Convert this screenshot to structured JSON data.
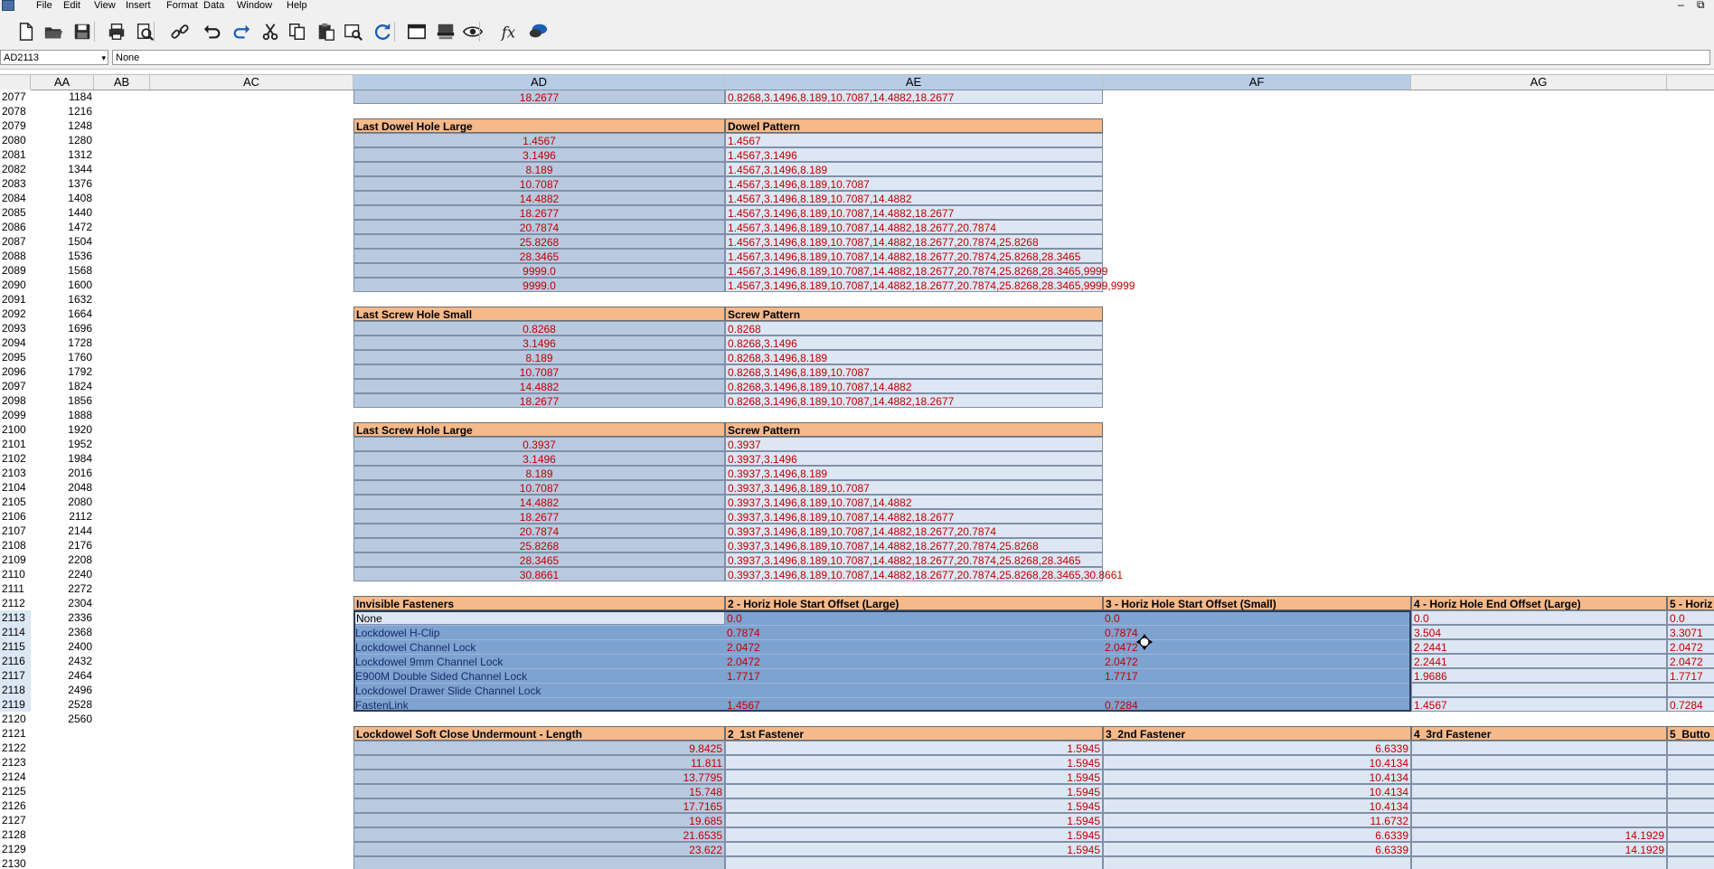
{
  "menu": [
    "File",
    "Edit",
    "View",
    "Insert",
    "Format",
    "Data",
    "Window",
    "Help"
  ],
  "window_controls": {
    "minimize": "–",
    "restore": "⧉"
  },
  "toolbar_icons": [
    "new-file-icon",
    "open-folder-icon",
    "save-icon",
    "print-icon",
    "print-preview-icon",
    "link-icon",
    "undo-icon",
    "redo-icon",
    "cut-icon",
    "copy-icon",
    "paste-icon",
    "find-icon",
    "refresh-icon",
    "window-icon",
    "display-icon",
    "eye-icon",
    "function-icon",
    "chat-icon"
  ],
  "namebox": "AD2113",
  "formula": "None",
  "columns": [
    {
      "label": "AA",
      "selected": false
    },
    {
      "label": "AB",
      "selected": false
    },
    {
      "label": "AC",
      "selected": false
    },
    {
      "label": "AD",
      "selected": true
    },
    {
      "label": "AE",
      "selected": true
    },
    {
      "label": "AF",
      "selected": true
    },
    {
      "label": "AG",
      "selected": false
    }
  ],
  "rows": [
    {
      "n": "2077",
      "aa": "1184",
      "cells": {
        "ad": {
          "t": "18.2677",
          "s": "dc"
        },
        "ae": {
          "t": "0.8268,3.1496,8.189,10.7087,14.4882,18.2677",
          "s": "dr"
        }
      }
    },
    {
      "n": "2078",
      "aa": "1216",
      "cells": {}
    },
    {
      "n": "2079",
      "aa": "1248",
      "cells": {
        "ad": {
          "t": "Last Dowel Hole Large",
          "s": "hdr"
        },
        "ae": {
          "t": "Dowel Pattern",
          "s": "hdr"
        }
      }
    },
    {
      "n": "2080",
      "aa": "1280",
      "cells": {
        "ad": {
          "t": "1.4567",
          "s": "dc"
        },
        "ae": {
          "t": "1.4567",
          "s": "dr"
        }
      }
    },
    {
      "n": "2081",
      "aa": "1312",
      "cells": {
        "ad": {
          "t": "3.1496",
          "s": "dc"
        },
        "ae": {
          "t": "1.4567,3.1496",
          "s": "dr"
        }
      }
    },
    {
      "n": "2082",
      "aa": "1344",
      "cells": {
        "ad": {
          "t": "8.189",
          "s": "dc"
        },
        "ae": {
          "t": "1.4567,3.1496,8.189",
          "s": "dr"
        }
      }
    },
    {
      "n": "2083",
      "aa": "1376",
      "cells": {
        "ad": {
          "t": "10.7087",
          "s": "dc"
        },
        "ae": {
          "t": "1.4567,3.1496,8.189,10.7087",
          "s": "dr"
        }
      }
    },
    {
      "n": "2084",
      "aa": "1408",
      "cells": {
        "ad": {
          "t": "14.4882",
          "s": "dc"
        },
        "ae": {
          "t": "1.4567,3.1496,8.189,10.7087,14.4882",
          "s": "dr"
        }
      }
    },
    {
      "n": "2085",
      "aa": "1440",
      "cells": {
        "ad": {
          "t": "18.2677",
          "s": "dc"
        },
        "ae": {
          "t": "1.4567,3.1496,8.189,10.7087,14.4882,18.2677",
          "s": "dr"
        }
      }
    },
    {
      "n": "2086",
      "aa": "1472",
      "cells": {
        "ad": {
          "t": "20.7874",
          "s": "dc"
        },
        "ae": {
          "t": "1.4567,3.1496,8.189,10.7087,14.4882,18.2677,20.7874",
          "s": "dr"
        }
      }
    },
    {
      "n": "2087",
      "aa": "1504",
      "cells": {
        "ad": {
          "t": "25.8268",
          "s": "dc"
        },
        "ae": {
          "t": "1.4567,3.1496,8.189,10.7087,14.4882,18.2677,20.7874,25.8268",
          "s": "dr"
        }
      }
    },
    {
      "n": "2088",
      "aa": "1536",
      "cells": {
        "ad": {
          "t": "28.3465",
          "s": "dc"
        },
        "ae": {
          "t": "1.4567,3.1496,8.189,10.7087,14.4882,18.2677,20.7874,25.8268,28.3465",
          "s": "dr"
        }
      }
    },
    {
      "n": "2089",
      "aa": "1568",
      "cells": {
        "ad": {
          "t": "9999.0",
          "s": "dc"
        },
        "ae": {
          "t": "1.4567,3.1496,8.189,10.7087,14.4882,18.2677,20.7874,25.8268,28.3465,9999",
          "s": "dr"
        }
      }
    },
    {
      "n": "2090",
      "aa": "1600",
      "cells": {
        "ad": {
          "t": "9999.0",
          "s": "dc"
        },
        "ae": {
          "t": "1.4567,3.1496,8.189,10.7087,14.4882,18.2677,20.7874,25.8268,28.3465,9999,9999",
          "s": "dr"
        }
      }
    },
    {
      "n": "2091",
      "aa": "1632",
      "cells": {}
    },
    {
      "n": "2092",
      "aa": "1664",
      "cells": {
        "ad": {
          "t": "Last Screw Hole Small",
          "s": "hdr"
        },
        "ae": {
          "t": "Screw Pattern",
          "s": "hdr"
        }
      }
    },
    {
      "n": "2093",
      "aa": "1696",
      "cells": {
        "ad": {
          "t": "0.8268",
          "s": "dc"
        },
        "ae": {
          "t": "0.8268",
          "s": "dr"
        }
      }
    },
    {
      "n": "2094",
      "aa": "1728",
      "cells": {
        "ad": {
          "t": "3.1496",
          "s": "dc"
        },
        "ae": {
          "t": "0.8268,3.1496",
          "s": "dr"
        }
      }
    },
    {
      "n": "2095",
      "aa": "1760",
      "cells": {
        "ad": {
          "t": "8.189",
          "s": "dc"
        },
        "ae": {
          "t": "0.8268,3.1496,8.189",
          "s": "dr"
        }
      }
    },
    {
      "n": "2096",
      "aa": "1792",
      "cells": {
        "ad": {
          "t": "10.7087",
          "s": "dc"
        },
        "ae": {
          "t": "0.8268,3.1496,8.189,10.7087",
          "s": "dr"
        }
      }
    },
    {
      "n": "2097",
      "aa": "1824",
      "cells": {
        "ad": {
          "t": "14.4882",
          "s": "dc"
        },
        "ae": {
          "t": "0.8268,3.1496,8.189,10.7087,14.4882",
          "s": "dr"
        }
      }
    },
    {
      "n": "2098",
      "aa": "1856",
      "cells": {
        "ad": {
          "t": "18.2677",
          "s": "dc"
        },
        "ae": {
          "t": "0.8268,3.1496,8.189,10.7087,14.4882,18.2677",
          "s": "dr"
        }
      }
    },
    {
      "n": "2099",
      "aa": "1888",
      "cells": {}
    },
    {
      "n": "2100",
      "aa": "1920",
      "cells": {
        "ad": {
          "t": "Last Screw Hole Large",
          "s": "hdr"
        },
        "ae": {
          "t": "Screw Pattern",
          "s": "hdr"
        }
      }
    },
    {
      "n": "2101",
      "aa": "1952",
      "cells": {
        "ad": {
          "t": "0.3937",
          "s": "dc"
        },
        "ae": {
          "t": "0.3937",
          "s": "dr"
        }
      }
    },
    {
      "n": "2102",
      "aa": "1984",
      "cells": {
        "ad": {
          "t": "3.1496",
          "s": "dc"
        },
        "ae": {
          "t": "0.3937,3.1496",
          "s": "dr"
        }
      }
    },
    {
      "n": "2103",
      "aa": "2016",
      "cells": {
        "ad": {
          "t": "8.189",
          "s": "dc"
        },
        "ae": {
          "t": "0.3937,3.1496,8.189",
          "s": "dr"
        }
      }
    },
    {
      "n": "2104",
      "aa": "2048",
      "cells": {
        "ad": {
          "t": "10.7087",
          "s": "dc"
        },
        "ae": {
          "t": "0.3937,3.1496,8.189,10.7087",
          "s": "dr"
        }
      }
    },
    {
      "n": "2105",
      "aa": "2080",
      "cells": {
        "ad": {
          "t": "14.4882",
          "s": "dc"
        },
        "ae": {
          "t": "0.3937,3.1496,8.189,10.7087,14.4882",
          "s": "dr"
        }
      }
    },
    {
      "n": "2106",
      "aa": "2112",
      "cells": {
        "ad": {
          "t": "18.2677",
          "s": "dc"
        },
        "ae": {
          "t": "0.3937,3.1496,8.189,10.7087,14.4882,18.2677",
          "s": "dr"
        }
      }
    },
    {
      "n": "2107",
      "aa": "2144",
      "cells": {
        "ad": {
          "t": "20.7874",
          "s": "dc"
        },
        "ae": {
          "t": "0.3937,3.1496,8.189,10.7087,14.4882,18.2677,20.7874",
          "s": "dr"
        }
      }
    },
    {
      "n": "2108",
      "aa": "2176",
      "cells": {
        "ad": {
          "t": "25.8268",
          "s": "dc"
        },
        "ae": {
          "t": "0.3937,3.1496,8.189,10.7087,14.4882,18.2677,20.7874,25.8268",
          "s": "dr"
        }
      }
    },
    {
      "n": "2109",
      "aa": "2208",
      "cells": {
        "ad": {
          "t": "28.3465",
          "s": "dc"
        },
        "ae": {
          "t": "0.3937,3.1496,8.189,10.7087,14.4882,18.2677,20.7874,25.8268,28.3465",
          "s": "dr"
        }
      }
    },
    {
      "n": "2110",
      "aa": "2240",
      "cells": {
        "ad": {
          "t": "30.8661",
          "s": "dc"
        },
        "ae": {
          "t": "0.3937,3.1496,8.189,10.7087,14.4882,18.2677,20.7874,25.8268,28.3465,30.8661",
          "s": "dr"
        }
      }
    },
    {
      "n": "2111",
      "aa": "2272",
      "cells": {}
    },
    {
      "n": "2112",
      "aa": "2304",
      "cells": {
        "ad": {
          "t": "Invisible Fasteners",
          "s": "hdr"
        },
        "ae": {
          "t": "2 - Horiz Hole Start Offset (Large)",
          "s": "hdr"
        },
        "af": {
          "t": "3 - Horiz Hole Start Offset (Small)",
          "s": "hdr"
        },
        "ag": {
          "t": "4 - Horiz Hole End Offset (Large)",
          "s": "hdr"
        },
        "ah": {
          "t": "5 - Horiz",
          "s": "hdr"
        }
      }
    },
    {
      "n": "2113",
      "aa": "2336",
      "sel": true,
      "cells": {
        "ad": {
          "t": "None",
          "s": "first"
        },
        "ae": {
          "t": "0.0",
          "s": "sr"
        },
        "af": {
          "t": "0.0",
          "s": "sr"
        },
        "ag": {
          "t": "0.0",
          "s": "dr"
        },
        "ah": {
          "t": "0.0",
          "s": "dr"
        }
      }
    },
    {
      "n": "2114",
      "aa": "2368",
      "sel": true,
      "cells": {
        "ad": {
          "t": "Lockdowel H-Clip",
          "s": "sl"
        },
        "ae": {
          "t": "0.7874",
          "s": "sr"
        },
        "af": {
          "t": "0.7874",
          "s": "sr"
        },
        "ag": {
          "t": "3.504",
          "s": "dr"
        },
        "ah": {
          "t": "3.3071",
          "s": "dr"
        }
      }
    },
    {
      "n": "2115",
      "aa": "2400",
      "sel": true,
      "cells": {
        "ad": {
          "t": "Lockdowel Channel Lock",
          "s": "sl"
        },
        "ae": {
          "t": "2.0472",
          "s": "sr"
        },
        "af": {
          "t": "2.0472",
          "s": "sr"
        },
        "ag": {
          "t": "2.2441",
          "s": "dr"
        },
        "ah": {
          "t": "2.0472",
          "s": "dr"
        }
      }
    },
    {
      "n": "2116",
      "aa": "2432",
      "sel": true,
      "cells": {
        "ad": {
          "t": "Lockdowel 9mm Channel Lock",
          "s": "sl"
        },
        "ae": {
          "t": "2.0472",
          "s": "sr"
        },
        "af": {
          "t": "2.0472",
          "s": "sr"
        },
        "ag": {
          "t": "2.2441",
          "s": "dr"
        },
        "ah": {
          "t": "2.0472",
          "s": "dr"
        }
      }
    },
    {
      "n": "2117",
      "aa": "2464",
      "sel": true,
      "cells": {
        "ad": {
          "t": "E900M Double Sided Channel Lock",
          "s": "sl"
        },
        "ae": {
          "t": "1.7717",
          "s": "sr"
        },
        "af": {
          "t": "1.7717",
          "s": "sr"
        },
        "ag": {
          "t": "1.9686",
          "s": "dr"
        },
        "ah": {
          "t": "1.7717",
          "s": "dr"
        }
      }
    },
    {
      "n": "2118",
      "aa": "2496",
      "sel": true,
      "cells": {
        "ad": {
          "t": "Lockdowel Drawer Slide Channel Lock",
          "s": "sl"
        },
        "ae": {
          "t": "",
          "s": "sr"
        },
        "af": {
          "t": "",
          "s": "sr"
        },
        "ag": {
          "t": "",
          "s": "dr"
        },
        "ah": {
          "t": "",
          "s": "dr"
        }
      }
    },
    {
      "n": "2119",
      "aa": "2528",
      "sel": true,
      "cells": {
        "ad": {
          "t": "FastenLink",
          "s": "sl"
        },
        "ae": {
          "t": "1.4567",
          "s": "sr"
        },
        "af": {
          "t": "0.7284",
          "s": "sr"
        },
        "ag": {
          "t": "1.4567",
          "s": "dr"
        },
        "ah": {
          "t": "0.7284",
          "s": "dr"
        }
      }
    },
    {
      "n": "2120",
      "aa": "2560",
      "cells": {}
    },
    {
      "n": "2121",
      "aa": "",
      "cells": {
        "ad": {
          "t": "Lockdowel Soft Close Undermount - Length",
          "s": "hdr"
        },
        "ae": {
          "t": "2_1st Fastener",
          "s": "hdr"
        },
        "af": {
          "t": "3_2nd Fastener",
          "s": "hdr"
        },
        "ag": {
          "t": "4_3rd Fastener",
          "s": "hdr"
        },
        "ah": {
          "t": "5_Butto",
          "s": "hdr"
        }
      }
    },
    {
      "n": "2122",
      "aa": "",
      "cells": {
        "ad": {
          "t": "9.8425",
          "s": "nl"
        },
        "ae": {
          "t": "1.5945",
          "s": "nr"
        },
        "af": {
          "t": "6.6339",
          "s": "nr"
        },
        "ag": {
          "t": "",
          "s": "nr"
        },
        "ah": {
          "t": "",
          "s": "nr"
        }
      }
    },
    {
      "n": "2123",
      "aa": "",
      "cells": {
        "ad": {
          "t": "11.811",
          "s": "nl"
        },
        "ae": {
          "t": "1.5945",
          "s": "nr"
        },
        "af": {
          "t": "10.4134",
          "s": "nr"
        },
        "ag": {
          "t": "",
          "s": "nr"
        },
        "ah": {
          "t": "",
          "s": "nr"
        }
      }
    },
    {
      "n": "2124",
      "aa": "",
      "cells": {
        "ad": {
          "t": "13.7795",
          "s": "nl"
        },
        "ae": {
          "t": "1.5945",
          "s": "nr"
        },
        "af": {
          "t": "10.4134",
          "s": "nr"
        },
        "ag": {
          "t": "",
          "s": "nr"
        },
        "ah": {
          "t": "",
          "s": "nr"
        }
      }
    },
    {
      "n": "2125",
      "aa": "",
      "cells": {
        "ad": {
          "t": "15.748",
          "s": "nl"
        },
        "ae": {
          "t": "1.5945",
          "s": "nr"
        },
        "af": {
          "t": "10.4134",
          "s": "nr"
        },
        "ag": {
          "t": "",
          "s": "nr"
        },
        "ah": {
          "t": "",
          "s": "nr"
        }
      }
    },
    {
      "n": "2126",
      "aa": "",
      "cells": {
        "ad": {
          "t": "17.7165",
          "s": "nl"
        },
        "ae": {
          "t": "1.5945",
          "s": "nr"
        },
        "af": {
          "t": "10.4134",
          "s": "nr"
        },
        "ag": {
          "t": "",
          "s": "nr"
        },
        "ah": {
          "t": "",
          "s": "nr"
        }
      }
    },
    {
      "n": "2127",
      "aa": "",
      "cells": {
        "ad": {
          "t": "19.685",
          "s": "nl"
        },
        "ae": {
          "t": "1.5945",
          "s": "nr"
        },
        "af": {
          "t": "11.6732",
          "s": "nr"
        },
        "ag": {
          "t": "",
          "s": "nr"
        },
        "ah": {
          "t": "",
          "s": "nr"
        }
      }
    },
    {
      "n": "2128",
      "aa": "",
      "cells": {
        "ad": {
          "t": "21.6535",
          "s": "nl"
        },
        "ae": {
          "t": "1.5945",
          "s": "nr"
        },
        "af": {
          "t": "6.6339",
          "s": "nr"
        },
        "ag": {
          "t": "14.1929",
          "s": "nr"
        },
        "ah": {
          "t": "",
          "s": "nr"
        }
      }
    },
    {
      "n": "2129",
      "aa": "",
      "cells": {
        "ad": {
          "t": "23.622",
          "s": "nl"
        },
        "ae": {
          "t": "1.5945",
          "s": "nr"
        },
        "af": {
          "t": "6.6339",
          "s": "nr"
        },
        "ag": {
          "t": "14.1929",
          "s": "nr"
        },
        "ah": {
          "t": "",
          "s": "nr"
        }
      }
    },
    {
      "n": "2130",
      "aa": "",
      "cells": {
        "ad": {
          "t": "",
          "s": "nl"
        },
        "ae": {
          "t": "",
          "s": "nr"
        },
        "af": {
          "t": "",
          "s": "nr"
        },
        "ag": {
          "t": "",
          "s": "nr"
        },
        "ah": {
          "t": "",
          "s": "nr"
        }
      }
    }
  ],
  "colors": {
    "header_orange": "#f5b98a",
    "data_blue": "#b8c9e0",
    "pattern_blue": "#dde6f3",
    "selection_blue": "#7ea3d0",
    "value_red": "#c00000"
  }
}
